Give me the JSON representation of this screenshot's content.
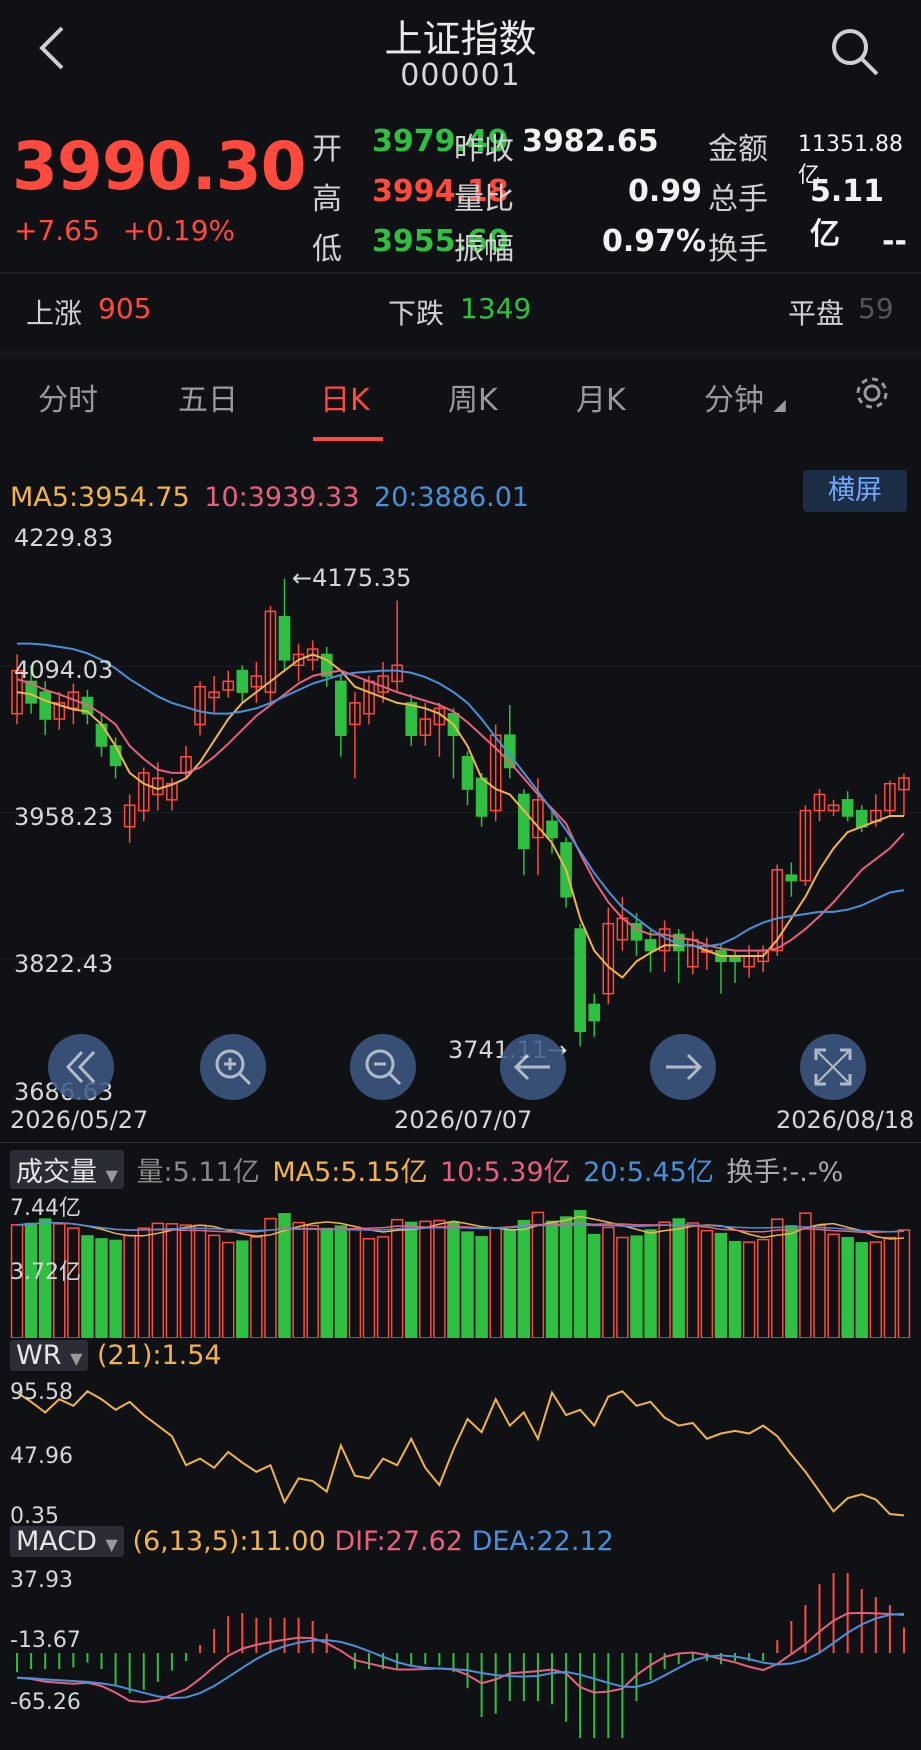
{
  "header": {
    "title": "上证指数",
    "code": "000001",
    "back_icon": "chevron-left-icon",
    "search_icon": "search-icon"
  },
  "quote": {
    "price": "3990.30",
    "change": "+7.65",
    "change_pct": "+0.19%",
    "open_label": "开",
    "open": "3979.49",
    "prev_close_label": "昨收",
    "prev_close": "3982.65",
    "amount_label": "金额",
    "amount": "11351.88亿",
    "high_label": "高",
    "high": "3994.18",
    "vol_ratio_label": "量比",
    "vol_ratio": "0.99",
    "total_hands_label": "总手",
    "total_hands": "5.11亿",
    "low_label": "低",
    "low": "3955.60",
    "amplitude_label": "振幅",
    "amplitude": "0.97%",
    "turnover_label": "换手",
    "turnover": "--"
  },
  "breadth": {
    "up_label": "上涨",
    "up": "905",
    "down_label": "下跌",
    "down": "1349",
    "flat_label": "平盘",
    "flat": "59"
  },
  "tabs": [
    "分时",
    "五日",
    "日K",
    "周K",
    "月K",
    "分钟"
  ],
  "active_tab": "日K",
  "kline": {
    "ma5": "MA5:3954.75",
    "ma10": "10:3939.33",
    "ma20": "20:3886.01",
    "landscape_button": "横屏",
    "y_labels": [
      "4229.83",
      "4094.03",
      "3958.23",
      "3822.43",
      "3686.63"
    ],
    "high_marker": "←4175.35",
    "low_marker": "3741.11→",
    "x_labels": [
      "2026/05/27",
      "2026/07/07",
      "2026/08/18"
    ]
  },
  "controls": [
    "double-left-icon",
    "zoom-in-icon",
    "zoom-out-icon",
    "arrow-left-icon",
    "arrow-right-icon",
    "fullscreen-icon"
  ],
  "volume": {
    "title": "成交量",
    "vol": "量:5.11亿",
    "ma5": "MA5:5.15亿",
    "ma10": "10:5.39亿",
    "ma20": "20:5.45亿",
    "turnover": "换手:-.-%",
    "y_labels": [
      "7.44亿",
      "3.72亿"
    ]
  },
  "wr": {
    "title": "WR",
    "value": "(21):1.54",
    "y_labels": [
      "95.58",
      "47.96",
      "0.35"
    ]
  },
  "macd": {
    "title": "MACD",
    "params": "(6,13,5):11.00",
    "dif": "DIF:27.62",
    "dea": "DEA:22.12",
    "y_labels": [
      "37.93",
      "-13.67",
      "-65.26"
    ]
  },
  "colors": {
    "up": "#ff4a3d",
    "down": "#2fbf41",
    "ma5": "#f2b44a",
    "ma10": "#e8607d",
    "ma20": "#4a90d9",
    "accent_blue": "#6fa8ff"
  },
  "chart_data": {
    "type": "candlestick",
    "x_range": [
      "2026/05/27",
      "2026/08/18"
    ],
    "ylim": [
      3686.63,
      4229.83
    ],
    "candles": [
      {
        "o": 4050,
        "c": 4090,
        "h": 4105,
        "l": 4040
      },
      {
        "o": 4080,
        "c": 4060,
        "h": 4095,
        "l": 4050
      },
      {
        "o": 4070,
        "c": 4045,
        "h": 4080,
        "l": 4030
      },
      {
        "o": 4045,
        "c": 4060,
        "h": 4070,
        "l": 4035
      },
      {
        "o": 4055,
        "c": 4070,
        "h": 4078,
        "l": 4040
      },
      {
        "o": 4065,
        "c": 4050,
        "h": 4072,
        "l": 4040
      },
      {
        "o": 4040,
        "c": 4020,
        "h": 4050,
        "l": 4010
      },
      {
        "o": 4020,
        "c": 4002,
        "h": 4028,
        "l": 3990
      },
      {
        "o": 3945,
        "c": 3965,
        "h": 3975,
        "l": 3930
      },
      {
        "o": 3960,
        "c": 3995,
        "h": 4000,
        "l": 3950
      },
      {
        "o": 3975,
        "c": 3990,
        "h": 4005,
        "l": 3960
      },
      {
        "o": 3970,
        "c": 3985,
        "h": 3990,
        "l": 3960
      },
      {
        "o": 3995,
        "c": 4010,
        "h": 4020,
        "l": 3990
      },
      {
        "o": 4040,
        "c": 4075,
        "h": 4080,
        "l": 4030
      },
      {
        "o": 4065,
        "c": 4070,
        "h": 4085,
        "l": 4050
      },
      {
        "o": 4072,
        "c": 4080,
        "h": 4090,
        "l": 4065
      },
      {
        "o": 4090,
        "c": 4070,
        "h": 4095,
        "l": 4060
      },
      {
        "o": 4075,
        "c": 4085,
        "h": 4098,
        "l": 4060
      },
      {
        "o": 4070,
        "c": 4145,
        "h": 4150,
        "l": 4060
      },
      {
        "o": 4140,
        "c": 4100,
        "h": 4175.35,
        "l": 4090
      },
      {
        "o": 4095,
        "c": 4105,
        "h": 4115,
        "l": 4080
      },
      {
        "o": 4100,
        "c": 4110,
        "h": 4118,
        "l": 4090
      },
      {
        "o": 4105,
        "c": 4085,
        "h": 4112,
        "l": 4075
      },
      {
        "o": 4080,
        "c": 4030,
        "h": 4085,
        "l": 4010
      },
      {
        "o": 4040,
        "c": 4060,
        "h": 4070,
        "l": 3990
      },
      {
        "o": 4050,
        "c": 4080,
        "h": 4085,
        "l": 4040
      },
      {
        "o": 4070,
        "c": 4085,
        "h": 4098,
        "l": 4060
      },
      {
        "o": 4080,
        "c": 4095,
        "h": 4155,
        "l": 4070
      },
      {
        "o": 4060,
        "c": 4030,
        "h": 4068,
        "l": 4020
      },
      {
        "o": 4030,
        "c": 4045,
        "h": 4060,
        "l": 4020
      },
      {
        "o": 4040,
        "c": 4055,
        "h": 4060,
        "l": 4010
      },
      {
        "o": 4050,
        "c": 4030,
        "h": 4055,
        "l": 3990
      },
      {
        "o": 4010,
        "c": 3980,
        "h": 4015,
        "l": 3965
      },
      {
        "o": 3990,
        "c": 3955,
        "h": 3995,
        "l": 3945
      },
      {
        "o": 3960,
        "c": 4030,
        "h": 4040,
        "l": 3950
      },
      {
        "o": 4030,
        "c": 4000,
        "h": 4058,
        "l": 3990
      },
      {
        "o": 3975,
        "c": 3925,
        "h": 3980,
        "l": 3900
      },
      {
        "o": 3935,
        "c": 3970,
        "h": 3990,
        "l": 3900
      },
      {
        "o": 3950,
        "c": 3935,
        "h": 3960,
        "l": 3920
      },
      {
        "o": 3930,
        "c": 3880,
        "h": 3935,
        "l": 3870
      },
      {
        "o": 3850,
        "c": 3755,
        "h": 3855,
        "l": 3741.11
      },
      {
        "o": 3780,
        "c": 3765,
        "h": 3790,
        "l": 3750
      },
      {
        "o": 3790,
        "c": 3855,
        "h": 3870,
        "l": 3780
      },
      {
        "o": 3840,
        "c": 3860,
        "h": 3880,
        "l": 3830
      },
      {
        "o": 3855,
        "c": 3840,
        "h": 3865,
        "l": 3825
      },
      {
        "o": 3840,
        "c": 3830,
        "h": 3850,
        "l": 3810
      },
      {
        "o": 3830,
        "c": 3850,
        "h": 3858,
        "l": 3810
      },
      {
        "o": 3845,
        "c": 3830,
        "h": 3850,
        "l": 3800
      },
      {
        "o": 3815,
        "c": 3840,
        "h": 3848,
        "l": 3808
      },
      {
        "o": 3830,
        "c": 3830,
        "h": 3842,
        "l": 3812
      },
      {
        "o": 3830,
        "c": 3820,
        "h": 3835,
        "l": 3790
      },
      {
        "o": 3825,
        "c": 3820,
        "h": 3830,
        "l": 3800
      },
      {
        "o": 3815,
        "c": 3825,
        "h": 3835,
        "l": 3805
      },
      {
        "o": 3820,
        "c": 3830,
        "h": 3835,
        "l": 3810
      },
      {
        "o": 3830,
        "c": 3905,
        "h": 3910,
        "l": 3825
      },
      {
        "o": 3900,
        "c": 3895,
        "h": 3912,
        "l": 3880
      },
      {
        "o": 3895,
        "c": 3960,
        "h": 3965,
        "l": 3890
      },
      {
        "o": 3960,
        "c": 3975,
        "h": 3980,
        "l": 3950
      },
      {
        "o": 3960,
        "c": 3965,
        "h": 3970,
        "l": 3955
      },
      {
        "o": 3970,
        "c": 3955,
        "h": 3978,
        "l": 3950
      },
      {
        "o": 3960,
        "c": 3945,
        "h": 3965,
        "l": 3940
      },
      {
        "o": 3950,
        "c": 3960,
        "h": 3975,
        "l": 3945
      },
      {
        "o": 3960,
        "c": 3985,
        "h": 3988,
        "l": 3955
      },
      {
        "o": 3979.49,
        "c": 3990.3,
        "h": 3994.18,
        "l": 3955.6
      }
    ],
    "ma5": [
      4070,
      4068,
      4062,
      4058,
      4054,
      4052,
      4040,
      4020,
      3995,
      3985,
      3980,
      3984,
      3990,
      4005,
      4025,
      4045,
      4060,
      4070,
      4080,
      4090,
      4100,
      4105,
      4100,
      4090,
      4075,
      4070,
      4065,
      4060,
      4058,
      4055,
      4050,
      4040,
      4020,
      3990,
      3980,
      3975,
      3960,
      3945,
      3930,
      3905,
      3860,
      3830,
      3815,
      3805,
      3820,
      3828,
      3835,
      3835,
      3835,
      3830,
      3825,
      3825,
      3825,
      3825,
      3840,
      3860,
      3880,
      3905,
      3925,
      3940,
      3945,
      3950,
      3955,
      3955
    ],
    "ma10": [
      4082,
      4078,
      4072,
      4068,
      4063,
      4058,
      4050,
      4040,
      4020,
      4008,
      3998,
      3995,
      3995,
      4000,
      4010,
      4022,
      4035,
      4048,
      4058,
      4068,
      4078,
      4085,
      4088,
      4090,
      4085,
      4080,
      4075,
      4070,
      4066,
      4062,
      4058,
      4052,
      4042,
      4030,
      4018,
      4005,
      3990,
      3975,
      3962,
      3948,
      3920,
      3895,
      3875,
      3860,
      3850,
      3845,
      3845,
      3842,
      3840,
      3835,
      3832,
      3830,
      3830,
      3830,
      3832,
      3840,
      3850,
      3862,
      3875,
      3890,
      3905,
      3915,
      3925,
      3939
    ],
    "ma20": [
      4115,
      4115,
      4114,
      4112,
      4110,
      4106,
      4100,
      4092,
      4082,
      4074,
      4066,
      4060,
      4056,
      4052,
      4050,
      4050,
      4052,
      4055,
      4060,
      4066,
      4072,
      4078,
      4082,
      4086,
      4088,
      4089,
      4090,
      4090,
      4088,
      4084,
      4078,
      4070,
      4060,
      4045,
      4028,
      4012,
      3995,
      3978,
      3960,
      3942,
      3922,
      3902,
      3885,
      3870,
      3860,
      3850,
      3842,
      3836,
      3834,
      3834,
      3836,
      3842,
      3850,
      3856,
      3860,
      3862,
      3864,
      3866,
      3866,
      3868,
      3872,
      3878,
      3884,
      3886
    ]
  }
}
